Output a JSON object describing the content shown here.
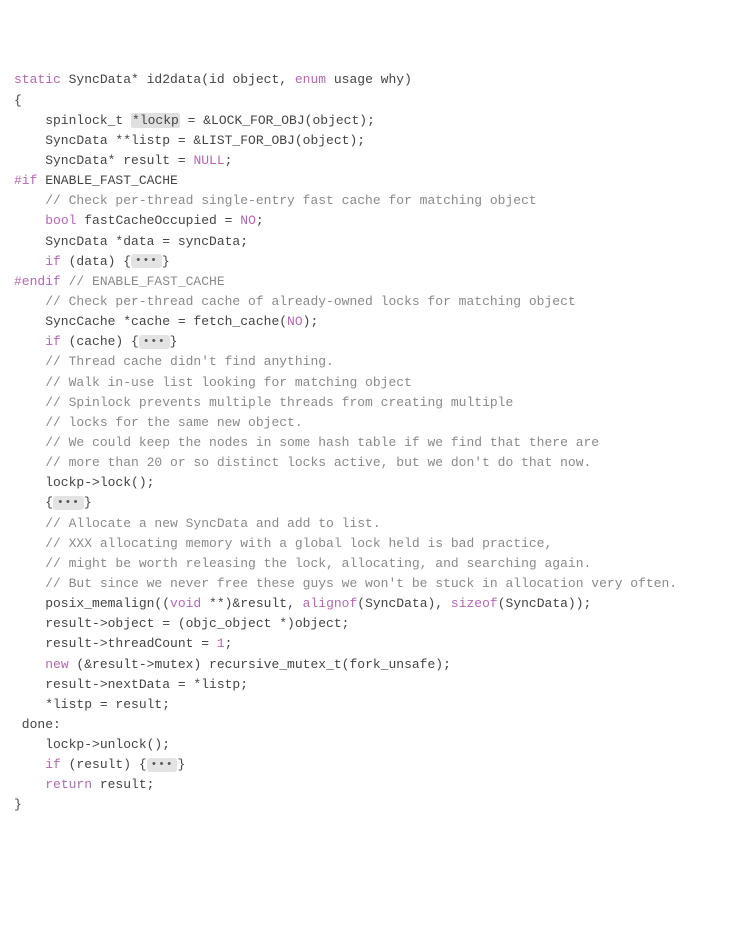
{
  "code": {
    "l1_static": "static",
    "l1_ret": " SyncData* id2data(id object, ",
    "l1_enum": "enum",
    "l1_rest": " usage why)",
    "l2": "{",
    "l3a": "    spinlock_t ",
    "l3hl": "*lockp",
    "l3b": " = &LOCK_FOR_OBJ(object);",
    "l4": "    SyncData **listp = &LIST_FOR_OBJ(object);",
    "l5a": "    SyncData* result = ",
    "l5b": "NULL",
    "l5c": ";",
    "l6": "",
    "l7a": "#if",
    "l7b": " ENABLE_FAST_CACHE",
    "l8": "    // Check per-thread single-entry fast cache for matching object",
    "l9a": "    ",
    "l9b": "bool",
    "l9c": " fastCacheOccupied = ",
    "l9d": "NO",
    "l9e": ";",
    "l10": "    SyncData *data = syncData;",
    "l11a": "    ",
    "l11b": "if",
    "l11c": " (data) {",
    "l11d": "}",
    "l12a": "#endif",
    "l12b": " // ENABLE_FAST_CACHE",
    "l13": "",
    "l14": "    // Check per-thread cache of already-owned locks for matching object",
    "l15a": "    SyncCache *cache = fetch_cache(",
    "l15b": "NO",
    "l15c": ");",
    "l16a": "    ",
    "l16b": "if",
    "l16c": " (cache) {",
    "l16d": "}",
    "l17": "",
    "l18": "    // Thread cache didn't find anything.",
    "l19": "    // Walk in-use list looking for matching object",
    "l20": "    // Spinlock prevents multiple threads from creating multiple",
    "l21": "    // locks for the same new object.",
    "l22": "    // We could keep the nodes in some hash table if we find that there are",
    "l23": "    // more than 20 or so distinct locks active, but we don't do that now.",
    "l24": "",
    "l25": "    lockp->lock();",
    "l26": "",
    "l27a": "    {",
    "l27b": "}",
    "l28": "",
    "l29": "    // Allocate a new SyncData and add to list.",
    "l30": "    // XXX allocating memory with a global lock held is bad practice,",
    "l31": "    // might be worth releasing the lock, allocating, and searching again.",
    "l32": "    // But since we never free these guys we won't be stuck in allocation very often.",
    "l33a": "    posix_memalign((",
    "l33b": "void",
    "l33c": " **)&result, ",
    "l33d": "alignof",
    "l33e": "(SyncData), ",
    "l33f": "sizeof",
    "l33g": "(SyncData));",
    "l34": "    result->object = (objc_object *)object;",
    "l35a": "    result->threadCount = ",
    "l35b": "1",
    "l35c": ";",
    "l36a": "    ",
    "l36b": "new",
    "l36c": " (&result->mutex) recursive_mutex_t(fork_unsafe);",
    "l37": "    result->nextData = *listp;",
    "l38": "    *listp = result;",
    "l39": "",
    "l40": " done:",
    "l41": "    lockp->unlock();",
    "l42a": "    ",
    "l42b": "if",
    "l42c": " (result) {",
    "l42d": "}",
    "l43": "",
    "l44a": "    ",
    "l44b": "return",
    "l44c": " result;",
    "l45": "}",
    "fold": "•••"
  }
}
